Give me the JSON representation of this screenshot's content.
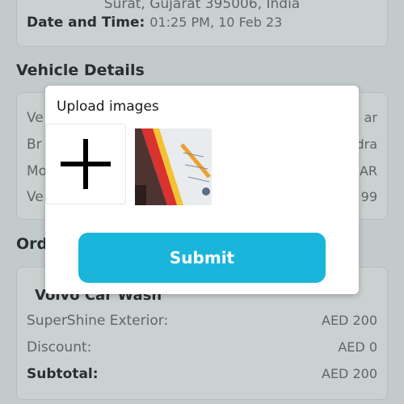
{
  "details": {
    "address_line": "Surat, Gujarat 395006, India",
    "date_label": "Date and Time:",
    "date_value": "01:25 PM, 10 Feb 23"
  },
  "vehicle": {
    "title": "Vehicle Details",
    "rows": [
      {
        "k": "Ve",
        "v": "ar"
      },
      {
        "k": "Br",
        "v": "dra"
      },
      {
        "k": "Mo",
        "v": "AR"
      },
      {
        "k": "Ve",
        "v": "99"
      }
    ]
  },
  "order": {
    "title": "Ord",
    "service_name": "Volvo Car Wash",
    "items": [
      {
        "label": "SuperShine Exterior:",
        "value": "AED 200"
      },
      {
        "label": "Discount:",
        "value": "AED 0"
      },
      {
        "label": "Subtotal:",
        "value": "AED 200"
      }
    ]
  },
  "modal": {
    "title": "Upload images",
    "add_icon": "plus-icon",
    "submit_label": "Submit"
  },
  "colors": {
    "accent": "#1ab5da",
    "overlay": "rgba(70,90,90,0.28)"
  }
}
